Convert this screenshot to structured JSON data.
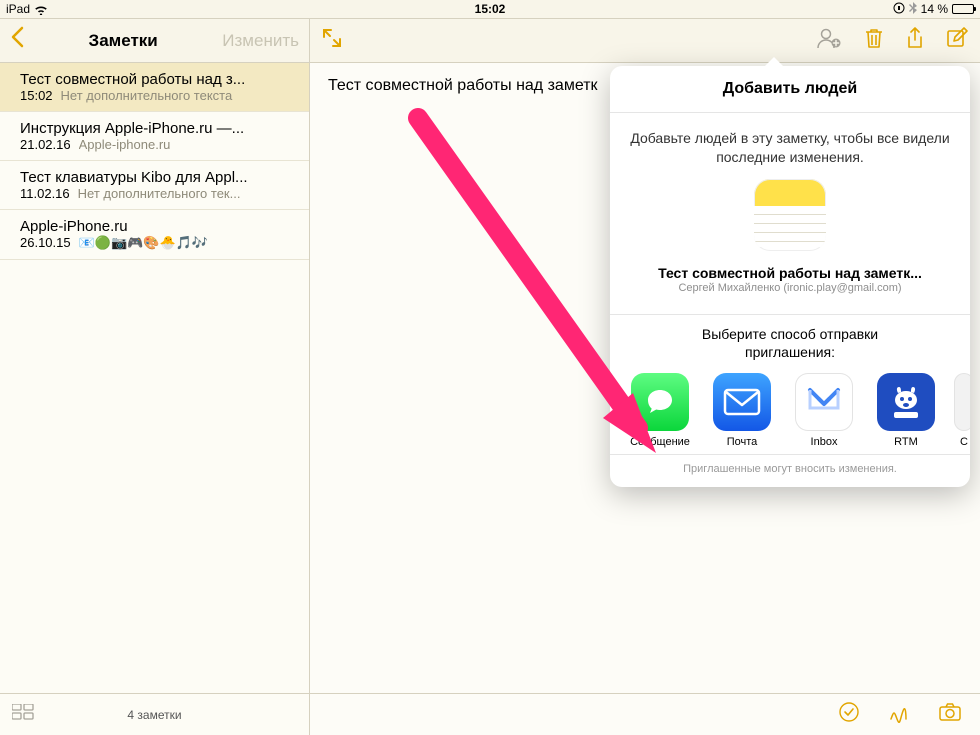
{
  "statusbar": {
    "device": "iPad",
    "time": "15:02",
    "battery_text": "14 %"
  },
  "sidebar": {
    "title": "Заметки",
    "edit": "Изменить",
    "count": "4 заметки",
    "items": [
      {
        "title": "Тест совместной работы над з...",
        "date": "15:02",
        "preview": "Нет дополнительного текста",
        "selected": true
      },
      {
        "title": "Инструкция Apple-iPhone.ru —...",
        "date": "21.02.16",
        "preview": "Apple-iphone.ru",
        "selected": false
      },
      {
        "title": "Тест клавиатуры Kibo для Appl...",
        "date": "11.02.16",
        "preview": "Нет дополнительного тек...",
        "selected": false
      },
      {
        "title": "Apple-iPhone.ru",
        "date": "26.10.15",
        "preview": "📧🟢📷🎮🎨🐣🎵🎶",
        "selected": false
      }
    ]
  },
  "detail": {
    "content": "Тест совместной работы над заметк"
  },
  "popover": {
    "title": "Добавить людей",
    "desc": "Добавьте людей в эту заметку, чтобы все видели последние изменения.",
    "note_name": "Тест совместной работы над заметк...",
    "note_owner": "Сергей Михайленко (ironic.play@gmail.com)",
    "select_method_l1": "Выберите способ отправки",
    "select_method_l2": "приглашения:",
    "footer": "Приглашенные могут вносить изменения.",
    "share_options": [
      {
        "label": "Сообщение",
        "kind": "messages"
      },
      {
        "label": "Почта",
        "kind": "mail"
      },
      {
        "label": "Inbox",
        "kind": "inbox"
      },
      {
        "label": "RTM",
        "kind": "rtm"
      },
      {
        "label": "C",
        "kind": "more"
      }
    ]
  }
}
